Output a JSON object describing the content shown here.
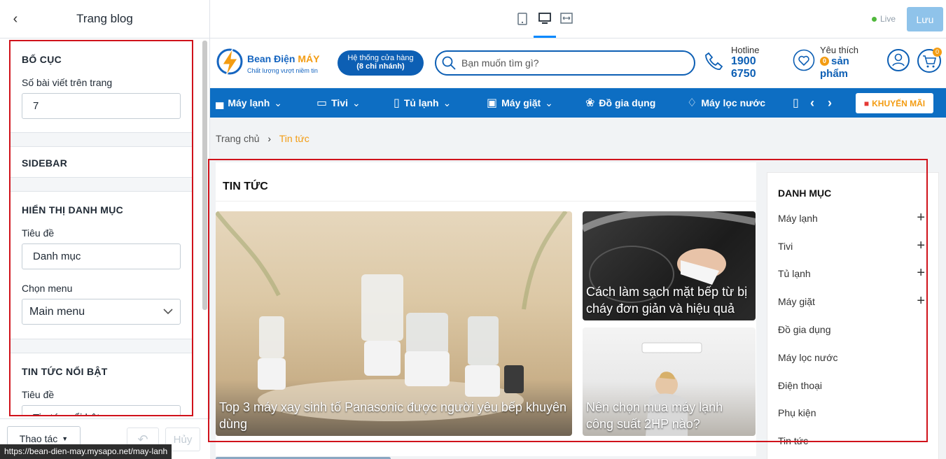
{
  "editor": {
    "title": "Trang blog",
    "sections": [
      {
        "heading": "BỐ CỤC",
        "fields": [
          {
            "label": "Số bài viết trên trang",
            "value": "7"
          }
        ]
      },
      {
        "heading": "SIDEBAR"
      },
      {
        "heading": "HIỂN THỊ DANH MỤC",
        "fields": [
          {
            "label": "Tiêu đề",
            "value": "Danh mục"
          },
          {
            "label": "Chọn menu",
            "value": "Main menu"
          }
        ]
      },
      {
        "heading": "TIN TỨC NỔI BẬT",
        "fields": [
          {
            "label": "Tiêu đề",
            "value": "Tin tức nổi bật"
          }
        ]
      }
    ],
    "footer": {
      "action_label": "Thao tác",
      "cancel_label": "Hủy"
    },
    "url_tooltip": "https://bean-dien-may.mysapo.net/may-lanh"
  },
  "topbar": {
    "live_label": "Live",
    "save_label": "Lưu"
  },
  "site": {
    "logo": {
      "name_a": "Bean Điện ",
      "name_b": "MÁY",
      "tagline": "Chất lượng vượt niềm tin"
    },
    "store_button": {
      "line1": "Hệ thống cửa hàng",
      "line2": "(8 chi nhánh)"
    },
    "search_placeholder": "Bạn muốn tìm gì?",
    "hotline": {
      "label": "Hotline",
      "line1": "1900",
      "line2": "6750"
    },
    "favorites": {
      "label": "Yêu thích",
      "count": "0",
      "line1": "sản",
      "line2": "phẩm"
    },
    "cart_count": "0",
    "nav": [
      "Máy lạnh",
      "Tivi",
      "Tủ lạnh",
      "Máy giặt",
      "Đồ gia dụng",
      "Máy lọc nước"
    ],
    "promo_label": "KHUYẾN MÃI",
    "breadcrumb": {
      "home": "Trang chủ",
      "current": "Tin tức"
    },
    "news_title": "TIN TỨC",
    "articles": [
      {
        "title": "Top 3 máy xay sinh tố Panasonic được người yêu bếp khuyên dùng"
      },
      {
        "title": "Cách làm sạch mặt bếp từ bị cháy đơn giản và hiệu quả"
      },
      {
        "title": "Nên chọn mua máy lạnh công suất 2HP nào?"
      }
    ],
    "sidebar": {
      "heading": "DANH MỤC",
      "items": [
        "Máy lạnh",
        "Tivi",
        "Tủ lạnh",
        "Máy giặt",
        "Đồ gia dụng",
        "Máy lọc nước",
        "Điện thoại",
        "Phụ kiện",
        "Tin tức"
      ]
    }
  }
}
